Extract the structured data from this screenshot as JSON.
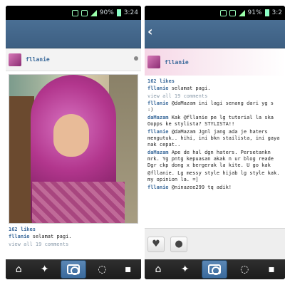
{
  "left": {
    "status": {
      "time": "3:24",
      "signal": "90%"
    },
    "post": {
      "username": "fllanie",
      "likes": "162 likes",
      "caption_user": "fllanie",
      "caption_text": "selamat pagi.",
      "view_all": "view all 19 comments"
    },
    "nav": [
      "home-icon",
      "explore-icon",
      "camera-icon",
      "news-icon",
      "profile-icon"
    ]
  },
  "right": {
    "status": {
      "signal": "91%",
      "time": "3:2"
    },
    "post": {
      "username": "fllanie",
      "likes": "162 likes",
      "comments": [
        {
          "user": "fllanie",
          "text": "selamat pagi."
        },
        {
          "user": "",
          "text": "view all 19 comments",
          "muted": true
        },
        {
          "user": "fllanie",
          "text": "@daMazam ini lagi senang dari yg s :)"
        },
        {
          "user": "daMazam",
          "text": "Kak @fllanie pe lg tutorial la ska Oopps ke stylista? STYLISTA!!"
        },
        {
          "user": "fllanie",
          "text": "@daMazam Jgnl jang ada je haters mengutuk.. hihi, ini bkn stailista, ini gaya nak cepat.."
        },
        {
          "user": "daMazam",
          "text": "Ape de hal dgn haters. Persetankn mrk. Yg pntg kepuasan akak n ur blog reade Dgr ckp dong x bergerak la kite. U go kak"
        },
        {
          "user": "",
          "text": "@fllanie. Lg messy style hijab lg style kak. my opinion la. =]"
        },
        {
          "user": "fllanie",
          "text": "@ninazee299 tq adik!"
        }
      ]
    },
    "nav": [
      "home-icon",
      "explore-icon",
      "camera-icon",
      "news-icon",
      "profile-icon"
    ]
  }
}
